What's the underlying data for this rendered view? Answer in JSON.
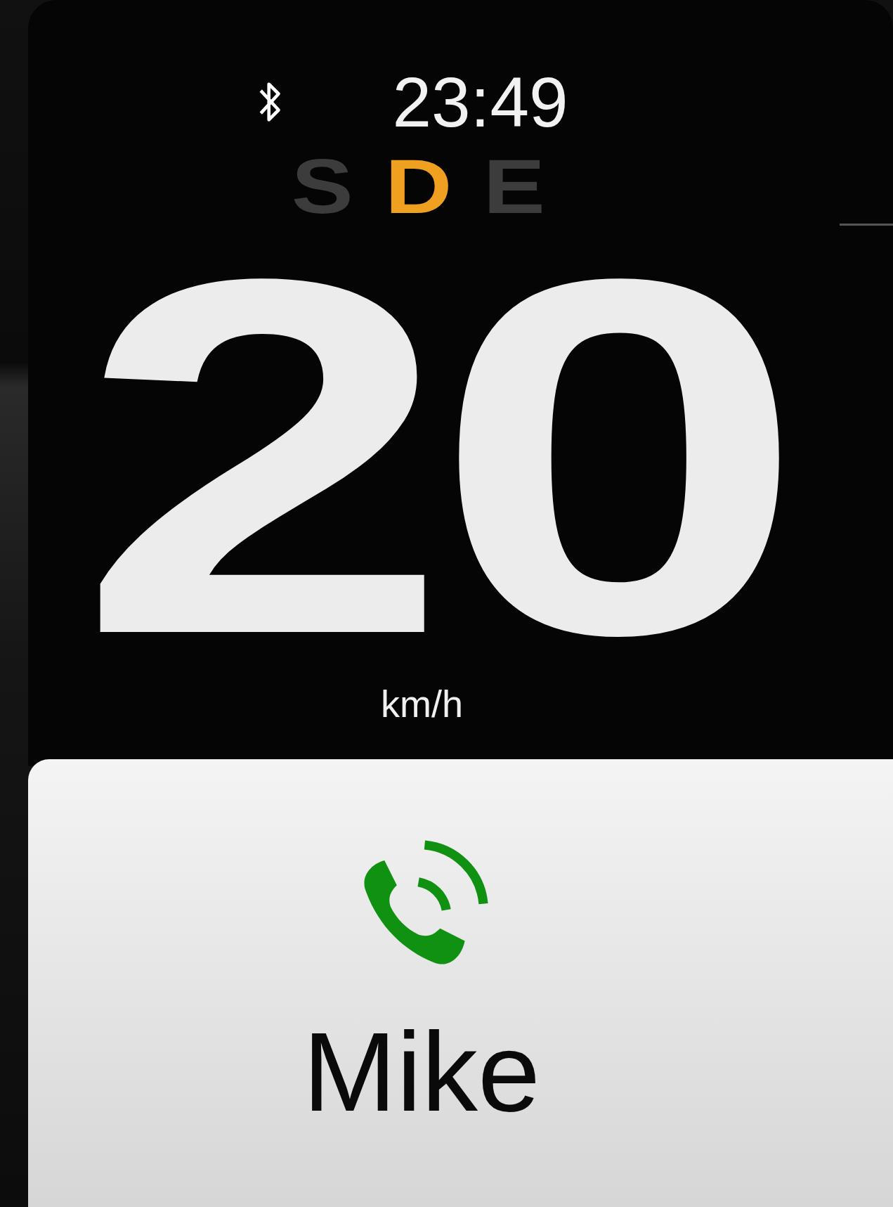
{
  "status_bar": {
    "bluetooth": true,
    "time": "23:49"
  },
  "gears": [
    {
      "label": "S",
      "selected": false
    },
    {
      "label": "D",
      "selected": true
    },
    {
      "label": "E",
      "selected": false
    }
  ],
  "speed": {
    "value": "20",
    "unit": "km/h"
  },
  "call_card": {
    "caller": "Mike"
  }
}
